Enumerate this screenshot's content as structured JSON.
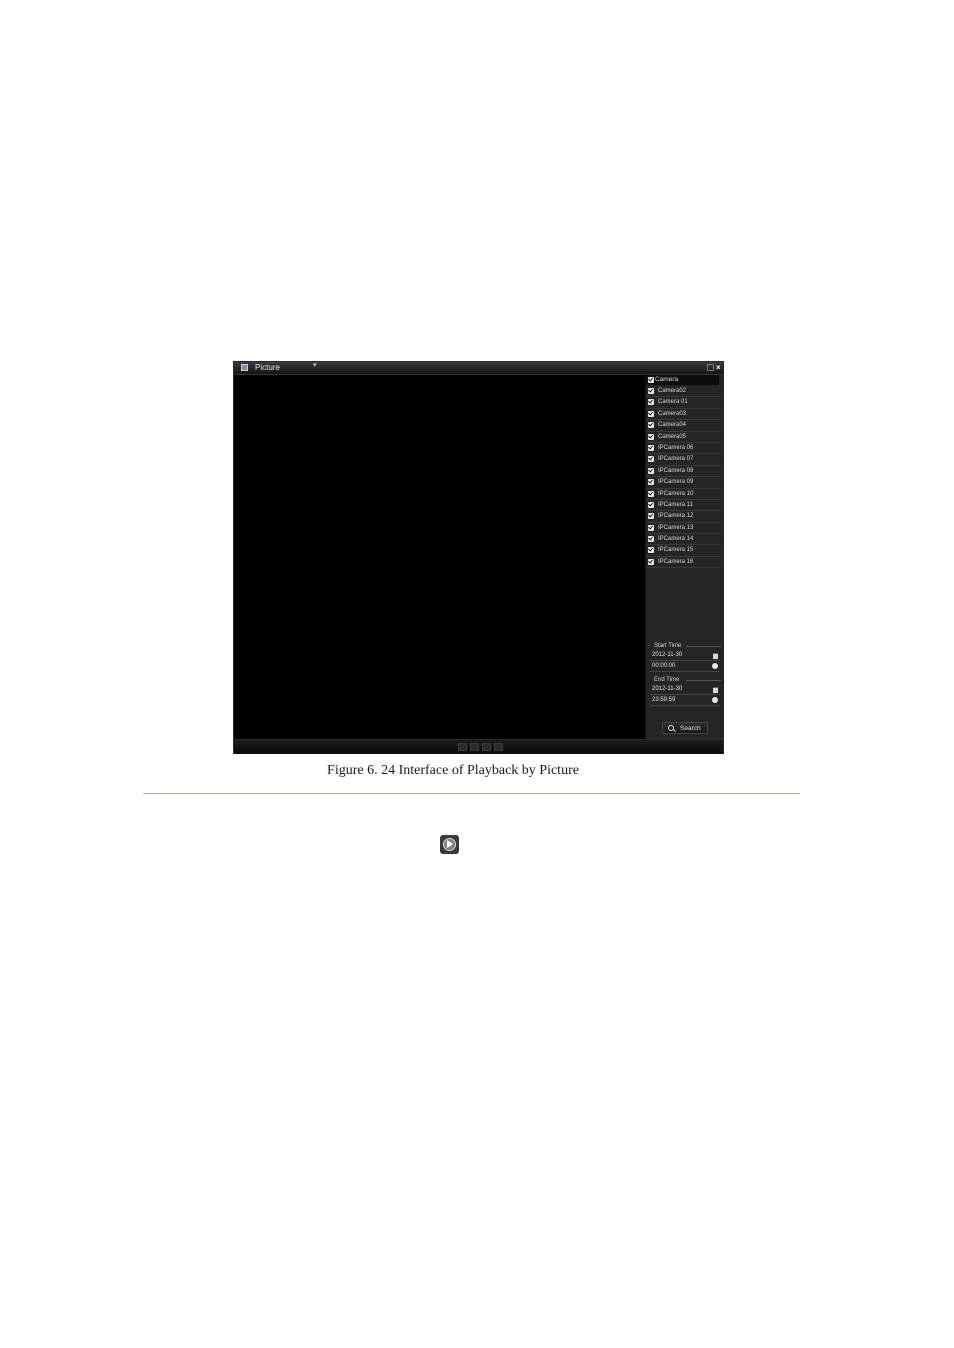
{
  "window": {
    "title": "Picture",
    "dropdown_caret": "▾",
    "close_glyph": "×"
  },
  "camera_panel": {
    "header_label": "Camera",
    "cameras": [
      "Camera02",
      "Camera 01",
      "Camera03",
      "Camera04",
      "Camera05",
      "IPCamera 06",
      "IPCamera 07",
      "IPCamera 08",
      "IPCamera 09",
      "IPCamera 10",
      "IPCamera 11",
      "IPCamera 12",
      "IPCamera 13",
      "IPCamera 14",
      "IPCamera 15",
      "IPCamera 16"
    ]
  },
  "start_time": {
    "label": "Start Time",
    "date": "2012-11-30",
    "time": "00:00:00"
  },
  "end_time": {
    "label": "End Time",
    "date": "2012-11-30",
    "time": "23:59:59"
  },
  "search_button": {
    "label": "Search"
  },
  "caption": {
    "text": "Figure 6. 24  Interface of Playback by Picture"
  },
  "colors": {
    "rule": "#b8b69a",
    "panel_bg": "#252525"
  }
}
